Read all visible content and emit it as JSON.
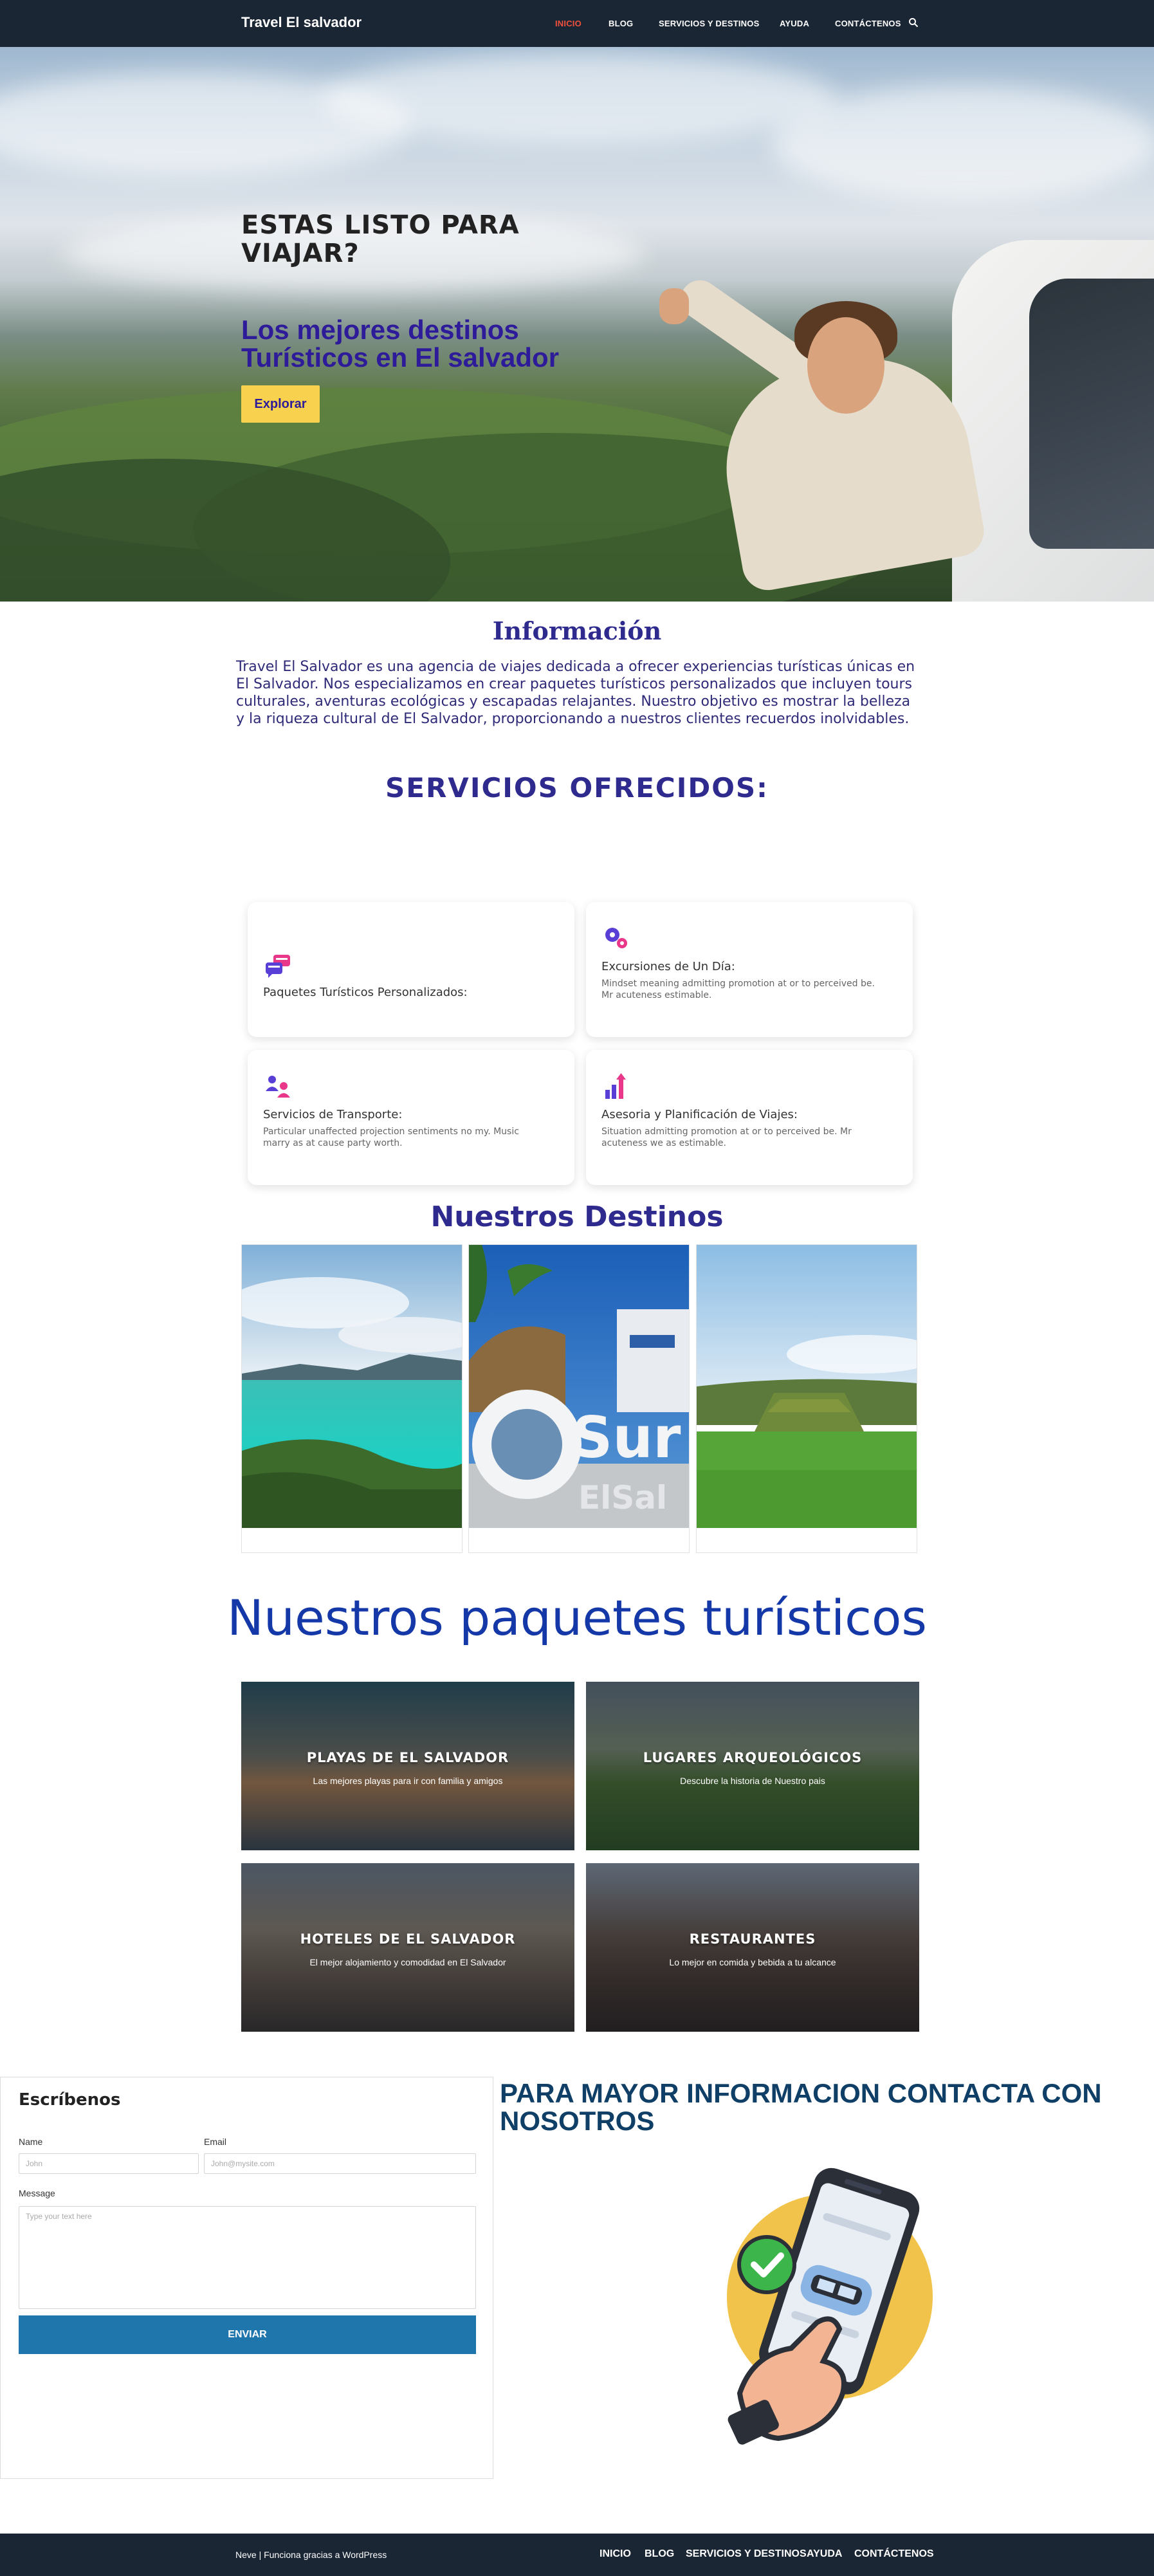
{
  "header": {
    "brand": "Travel El salvador",
    "nav": [
      "INICIO",
      "BLOG",
      "SERVICIOS Y DESTINOS",
      "AYUDA",
      "CONTÁCTENOS"
    ],
    "active": "INICIO",
    "search_icon": "search-icon"
  },
  "hero": {
    "title": "ESTAS LISTO PARA VIAJAR?",
    "subtitle": "Los mejores destinos Turísticos en El salvador",
    "button": "Explorar",
    "button_color": "#f8d24f"
  },
  "info": {
    "title": "Información",
    "text": "Travel El Salvador es una agencia de viajes dedicada a ofrecer experiencias turísticas únicas en El Salvador. Nos especializamos en crear paquetes turísticos personalizados que incluyen tours culturales, aventuras ecológicas y escapadas relajantes. Nuestro objetivo es mostrar la belleza y la riqueza cultural de El Salvador, proporcionando a nuestros clientes recuerdos inolvidables."
  },
  "services": {
    "title": "SERVICIOS OFRECIDOS:",
    "items": [
      {
        "title": "Paquetes Turísticos Personalizados:",
        "desc": "",
        "icon": "chat-bubbles-icon"
      },
      {
        "title": "Excursiones de Un Día:",
        "desc": "Mindset meaning admitting promotion at or to perceived be. Mr acuteness estimable.",
        "icon": "gears-icon"
      },
      {
        "title": "Servicios de Transporte:",
        "desc": "Particular unaffected projection sentiments no my. Music marry as at cause party worth.",
        "icon": "users-exchange-icon"
      },
      {
        "title": "Asesoria y Planificación de Viajes:",
        "desc": "Situation admitting promotion at or to perceived be. Mr acuteness we as estimable.",
        "icon": "growth-chart-icon"
      }
    ]
  },
  "destinations": {
    "title": "Nuestros Destinos"
  },
  "packages": {
    "title": "Nuestros paquetes turísticos",
    "items": [
      {
        "title": "PLAYAS DE EL SALVADOR",
        "subtitle": "Las mejores playas para ir con familia y amigos"
      },
      {
        "title": "LUGARES ARQUEOLÓGICOS",
        "subtitle": "Descubre la historia de Nuestro pais"
      },
      {
        "title": "HOTELES DE EL SALVADOR",
        "subtitle": "El mejor alojamiento y comodidad en El Salvador"
      },
      {
        "title": "RESTAURANTES",
        "subtitle": "Lo mejor en comida y bebida a tu alcance"
      }
    ]
  },
  "contact_form": {
    "title": "Escríbenos",
    "name_label": "Name",
    "name_placeholder": "John",
    "email_label": "Email",
    "email_placeholder": "John@mysite.com",
    "message_label": "Message",
    "message_placeholder": "Type your text here",
    "submit": "ENVIAR",
    "button_color": "#1f76ad"
  },
  "contact": {
    "title": "PARA MAYOR INFORMACION CONTACTA CON NOSOTROS"
  },
  "footer": {
    "credit": "Neve | Funciona gracias a WordPress",
    "nav": [
      "INICIO",
      "BLOG",
      "SERVICIOS Y DESTINOS",
      "AYUDA",
      "CONTÁCTENOS"
    ]
  }
}
